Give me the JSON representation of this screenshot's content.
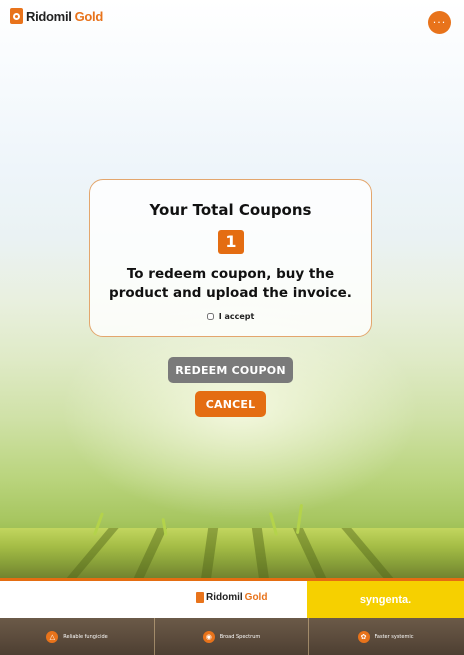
{
  "header": {
    "logo_ridomil": "Ridomil",
    "logo_gold": "Gold",
    "menu_icon": "more-horizontal-icon",
    "menu_glyph": "···"
  },
  "card": {
    "title": "Your Total Coupons",
    "count": "1",
    "message": "To redeem coupon, buy the product and upload the invoice.",
    "accept_label": "I accept",
    "accept_checked": false
  },
  "actions": {
    "redeem_label": "REDEEM COUPON",
    "cancel_label": "CANCEL"
  },
  "footer": {
    "logo_ridomil": "Ridomil",
    "logo_gold": "Gold",
    "brand": "syngenta.",
    "features": [
      {
        "label": "Reliable fungicide",
        "icon": "flame-icon"
      },
      {
        "label": "Broad Spectrum",
        "icon": "spectrum-icon"
      },
      {
        "label": "Faster systemic",
        "icon": "leaf-icon"
      }
    ]
  },
  "colors": {
    "accent": "#e46d12",
    "redeem_button": "#7a7a7a",
    "card_border": "#e3a66d",
    "brand_yellow": "#f6d000"
  }
}
